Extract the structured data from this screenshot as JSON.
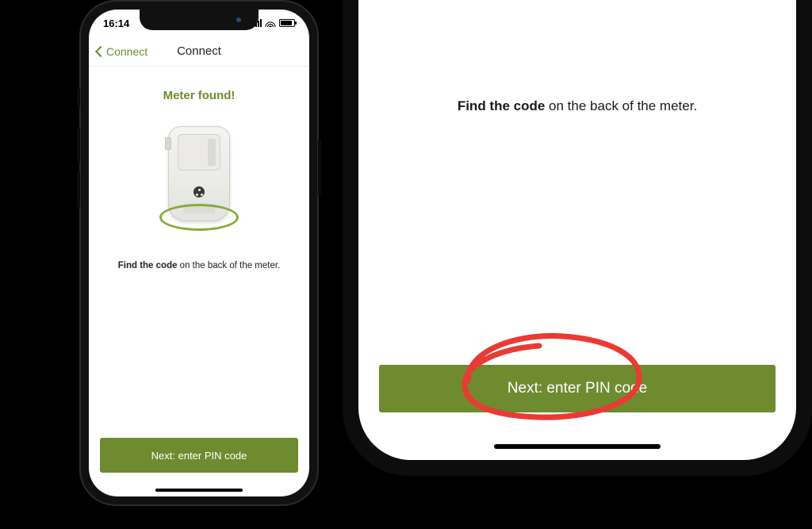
{
  "status": {
    "time": "16:14"
  },
  "nav": {
    "back_label": "Connect",
    "title": "Connect"
  },
  "headline": "Meter found!",
  "instruction": {
    "bold": "Find the code",
    "rest": " on the back of the meter."
  },
  "cta": "Next: enter PIN code",
  "colors": {
    "accent": "#6e8b2f",
    "annotation": "#ea3a33"
  }
}
